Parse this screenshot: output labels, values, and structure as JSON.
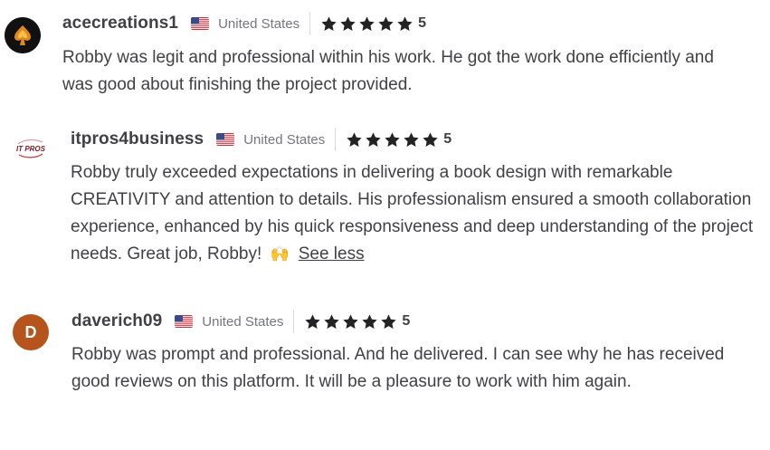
{
  "reviews": [
    {
      "username": "acecreations1",
      "country": "United States",
      "rating": "5",
      "avatar": "spade-logo-icon",
      "text": "Robby was legit and professional within his work. He got the work done efficiently and was good about finishing the project provided."
    },
    {
      "username": "itpros4business",
      "country": "United States",
      "rating": "5",
      "avatar": "it-pros-logo-icon",
      "avatar_text": "IT PROS",
      "text": "Robby truly exceeded expectations in delivering a book design with remarkable CREATIVITY and attention to details. His professionalism ensured a smooth collaboration experience, enhanced by his quick responsiveness and deep understanding of the project needs. Great job, Robby!",
      "emoji": "🙌",
      "see_less": "See less"
    },
    {
      "username": "daverich09",
      "country": "United States",
      "rating": "5",
      "avatar_letter": "D",
      "text": "Robby was prompt and professional. And he delivered. I can see why he has received good reviews on this platform. It will be a pleasure to work with him again."
    }
  ],
  "star_icon": "star-icon",
  "flag_icon": "us-flag-icon",
  "colors": {
    "text": "#404145",
    "muted": "#74767e",
    "avatar_letter_bg": "#b5541c"
  }
}
